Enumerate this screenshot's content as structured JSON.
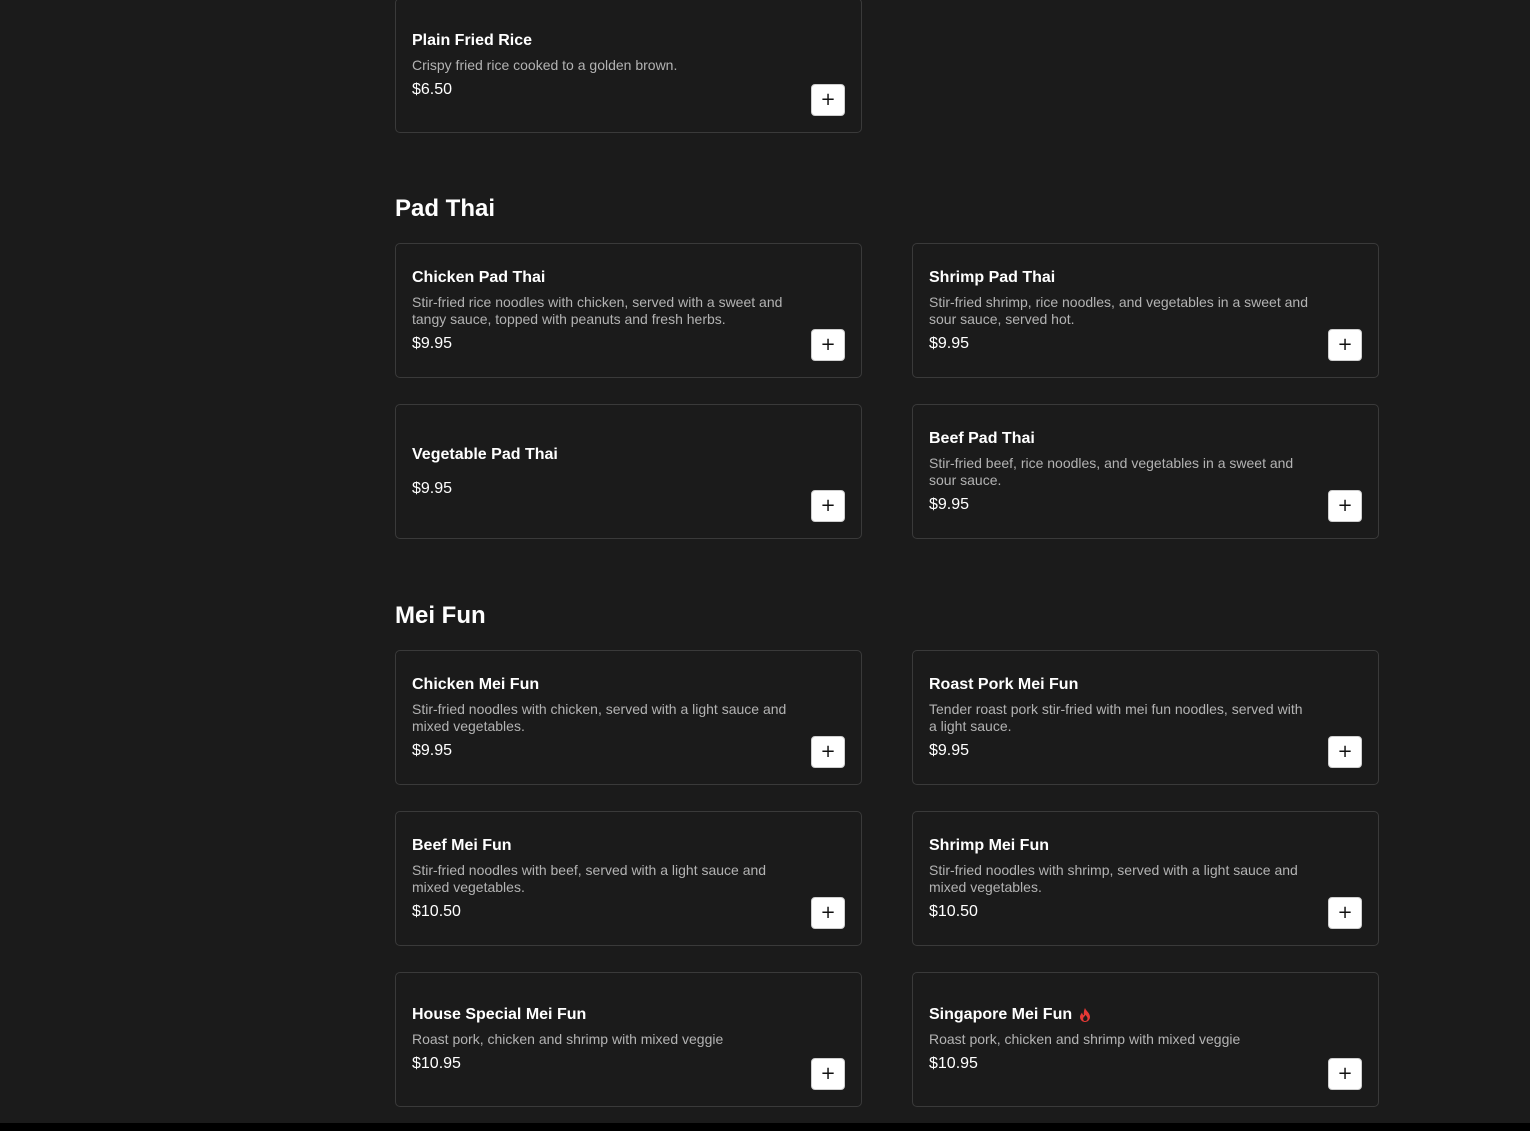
{
  "sections": [
    {
      "title": "",
      "items": [
        {
          "name": "Plain Fried Rice",
          "description": "Crispy fried rice cooked to a golden brown.",
          "price": "$6.50",
          "add_label": "+"
        }
      ]
    },
    {
      "title": "Pad Thai",
      "items": [
        {
          "name": "Chicken Pad Thai",
          "description": "Stir-fried rice noodles with chicken, served with a sweet and tangy sauce, topped with peanuts and fresh herbs.",
          "price": "$9.95",
          "add_label": "+"
        },
        {
          "name": "Shrimp Pad Thai",
          "description": "Stir-fried shrimp, rice noodles, and vegetables in a sweet and sour sauce, served hot.",
          "price": "$9.95",
          "add_label": "+"
        },
        {
          "name": "Vegetable Pad Thai",
          "description": "",
          "price": "$9.95",
          "add_label": "+"
        },
        {
          "name": "Beef Pad Thai",
          "description": "Stir-fried beef, rice noodles, and vegetables in a sweet and sour sauce.",
          "price": "$9.95",
          "add_label": "+"
        }
      ]
    },
    {
      "title": "Mei Fun",
      "items": [
        {
          "name": "Chicken Mei Fun",
          "description": "Stir-fried noodles with chicken, served with a light sauce and mixed vegetables.",
          "price": "$9.95",
          "add_label": "+"
        },
        {
          "name": "Roast Pork Mei Fun",
          "description": "Tender roast pork stir-fried with mei fun noodles, served with a light sauce.",
          "price": "$9.95",
          "add_label": "+"
        },
        {
          "name": "Beef Mei Fun",
          "description": "Stir-fried noodles with beef, served with a light sauce and mixed vegetables.",
          "price": "$10.50",
          "add_label": "+"
        },
        {
          "name": "Shrimp Mei Fun",
          "description": "Stir-fried noodles with shrimp, served with a light sauce and mixed vegetables.",
          "price": "$10.50",
          "add_label": "+"
        },
        {
          "name": "House Special Mei Fun",
          "description": "Roast pork, chicken and shrimp with mixed veggie",
          "price": "$10.95",
          "add_label": "+"
        },
        {
          "name": "Singapore Mei Fun",
          "description": "Roast pork, chicken and shrimp with mixed veggie",
          "price": "$10.95",
          "add_label": "+",
          "icon": "fire-icon",
          "icon_color": "#e53935"
        }
      ]
    }
  ]
}
